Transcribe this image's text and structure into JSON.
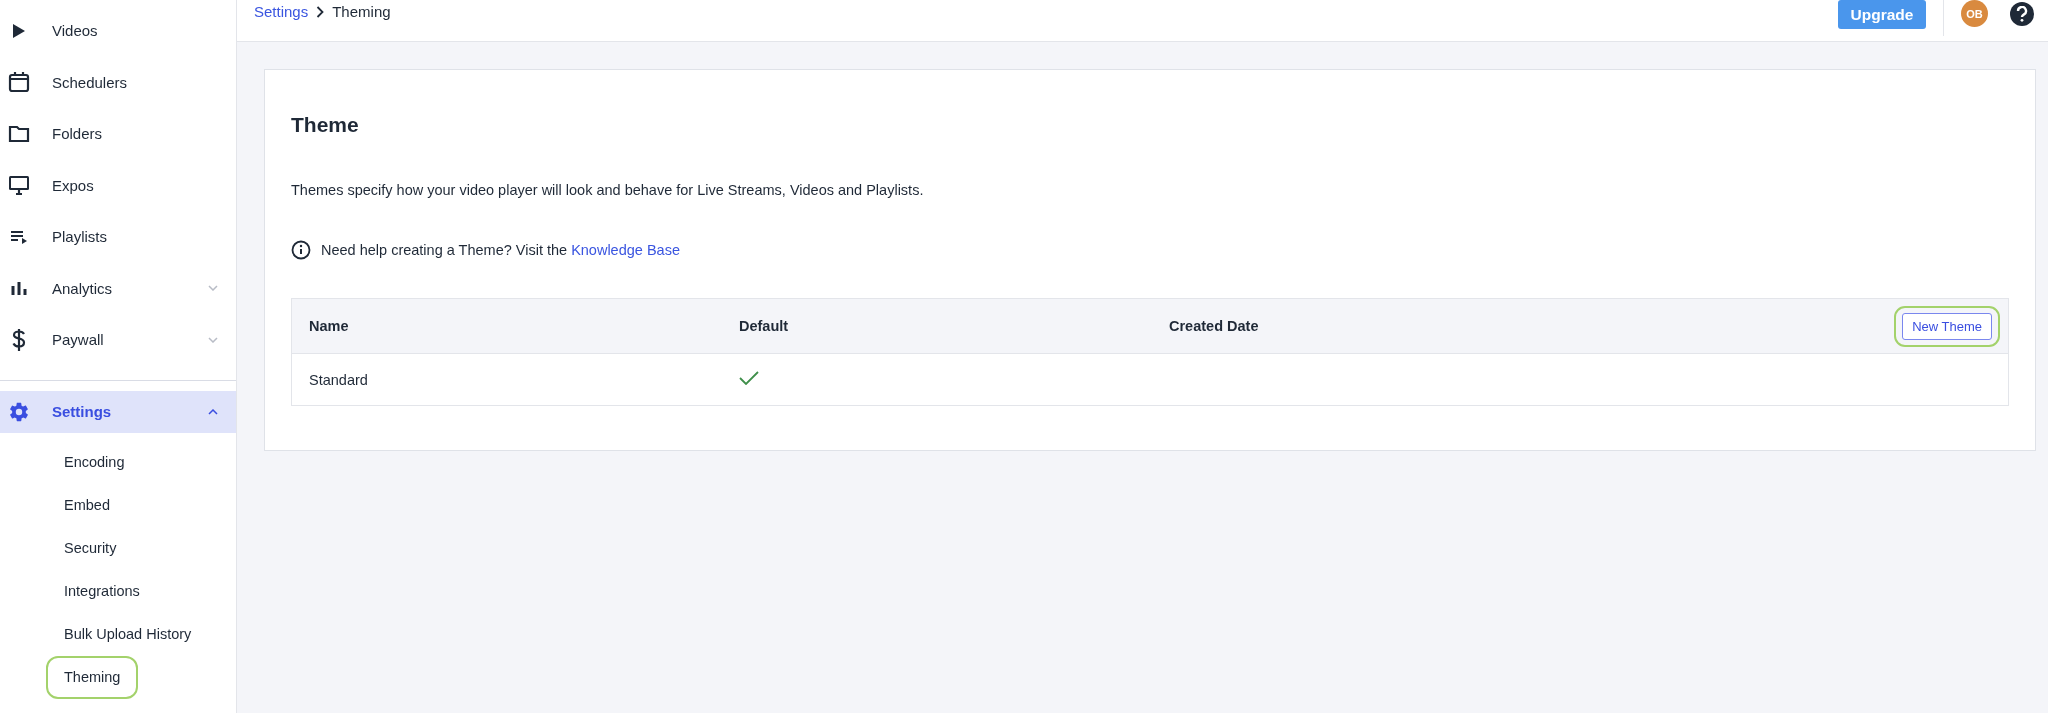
{
  "sidebar": {
    "items": [
      {
        "label": "Videos",
        "kind": "play",
        "selected": false
      },
      {
        "label": "Schedulers",
        "kind": "calendar",
        "selected": false
      },
      {
        "label": "Folders",
        "kind": "folder",
        "selected": false
      },
      {
        "label": "Expos",
        "kind": "monitor",
        "selected": false
      },
      {
        "label": "Playlists",
        "kind": "playlist",
        "selected": false
      },
      {
        "label": "Analytics",
        "kind": "chart",
        "selected": false,
        "expanded": false
      },
      {
        "label": "Paywall",
        "kind": "dollar",
        "selected": false,
        "expanded": false
      }
    ],
    "settings": {
      "label": "Settings",
      "selected": true,
      "expanded": true,
      "children": [
        {
          "label": "Encoding",
          "highlighted": false
        },
        {
          "label": "Embed",
          "highlighted": false
        },
        {
          "label": "Security",
          "highlighted": false
        },
        {
          "label": "Integrations",
          "highlighted": false
        },
        {
          "label": "Bulk Upload History",
          "highlighted": false
        },
        {
          "label": "Theming",
          "highlighted": true
        }
      ]
    }
  },
  "breadcrumb": [
    {
      "label": "Settings",
      "link": true
    },
    {
      "label": "Theming",
      "link": false
    }
  ],
  "header": {
    "upgrade": "Upgrade",
    "avatar": "OB"
  },
  "card": {
    "title": "Theme",
    "description": "Themes specify how your video player will look and behave for Live Streams, Videos and Playlists.",
    "help_text": "Need help creating a Theme? Visit the",
    "help_link": "Knowledge Base"
  },
  "table": {
    "columns": [
      "Name",
      "Default",
      "Created Date"
    ],
    "new_button": {
      "label": "New Theme",
      "highlighted": true
    },
    "rows": [
      {
        "name": "Standard",
        "default": true
      }
    ]
  }
}
